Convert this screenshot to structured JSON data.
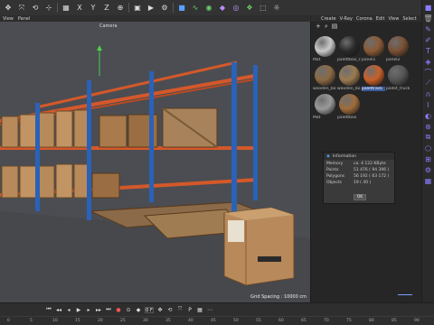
{
  "menu_left": [
    "View",
    "Panel"
  ],
  "menu_right": [
    "Create",
    "V-Ray",
    "Corona",
    "Edit",
    "View",
    "Select"
  ],
  "viewport": {
    "camera_label": "Camera",
    "grid_spacing": "Grid Spacing : 10000 cm"
  },
  "toolbar_icons": [
    "move-icon",
    "scale-icon",
    "rotate-icon",
    "snap-icon",
    "grid-icon",
    "x-axis-icon",
    "y-axis-icon",
    "z-axis-icon",
    "coord-icon",
    "render-view-icon",
    "render-icon",
    "render-settings-icon",
    "cube-icon",
    "spline-icon",
    "nurbs-icon",
    "deformer-icon",
    "field-icon",
    "scene-icon",
    "camera-icon",
    "light-icon"
  ],
  "materials": [
    {
      "name": "Mat",
      "color": "#c9c9c9"
    },
    {
      "name": "palettbox_c",
      "color": "#2a2a2a"
    },
    {
      "name": "panel1",
      "color": "#8a5a36"
    },
    {
      "name": "panel2",
      "color": "#7a5034"
    },
    {
      "name": "wooden_bo",
      "color": "#8b6a44"
    },
    {
      "name": "wooden_bo",
      "color": "#9b7a50"
    },
    {
      "name": "palettrack",
      "color": "#c8602a"
    },
    {
      "name": "pallet_truck",
      "color": "#555555"
    },
    {
      "name": "Mat",
      "color": "#9a9a9a"
    },
    {
      "name": "palettbox",
      "color": "#a06c3c"
    }
  ],
  "selected_material_index": 6,
  "dialog": {
    "title": "Information",
    "rows": [
      {
        "k": "Memory",
        "v": "ca. 4 122 KByte"
      },
      {
        "k": "Points",
        "v": "51 476 ( 94 396 )"
      },
      {
        "k": "Polygons",
        "v": "56 192 ( 63 172 )"
      },
      {
        "k": "Objects",
        "v": "19 ( 40 )"
      }
    ],
    "ok": "OK"
  },
  "timeline": {
    "frame": "0 F",
    "ticks": [
      "0",
      "5",
      "10",
      "15",
      "20",
      "25",
      "30",
      "35",
      "40",
      "45",
      "50",
      "55",
      "60",
      "65",
      "70",
      "75",
      "80",
      "85",
      "90"
    ]
  },
  "colors": {
    "rack_upright": "#2a62b8",
    "rack_beam": "#d4582a",
    "box": "#b8895a",
    "accent": "#8a7dff"
  }
}
